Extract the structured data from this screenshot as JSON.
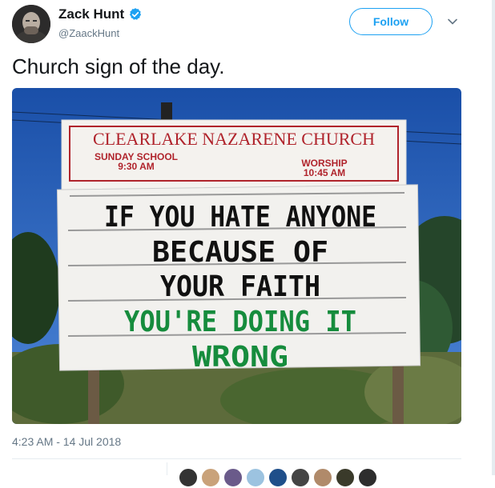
{
  "author": {
    "display_name": "Zack Hunt",
    "handle": "@ZaackHunt",
    "verified": true,
    "verified_icon": "verified-badge-icon"
  },
  "follow_button": {
    "label": "Follow"
  },
  "menu_icon": "chevron-down-icon",
  "tweet": {
    "text": "Church sign of the day.",
    "timestamp": "4:23 AM - 14 Jul 2018"
  },
  "photo": {
    "header_name": "CLEARLAKE NAZARENE CHURCH",
    "left_service_line1": "SUNDAY SCHOOL",
    "left_service_line2": "9:30 AM",
    "right_service_line1": "WORSHIP",
    "right_service_line2": "10:45 AM",
    "message_lines": [
      "IF YOU HATE ANYONE",
      "BECAUSE OF",
      "YOUR FAITH",
      "YOU'RE DOING IT",
      "WRONG"
    ],
    "colors": {
      "sky": "#1e58b5",
      "sign_red": "#b0242c",
      "black_letters": "#111111",
      "green_letters": "#168c3d"
    }
  },
  "stats": {
    "retweets": "",
    "likes": ""
  },
  "colors": {
    "accent": "#1da1f2",
    "text": "#14171a",
    "secondary": "#657786",
    "border": "#e6ecf0"
  }
}
